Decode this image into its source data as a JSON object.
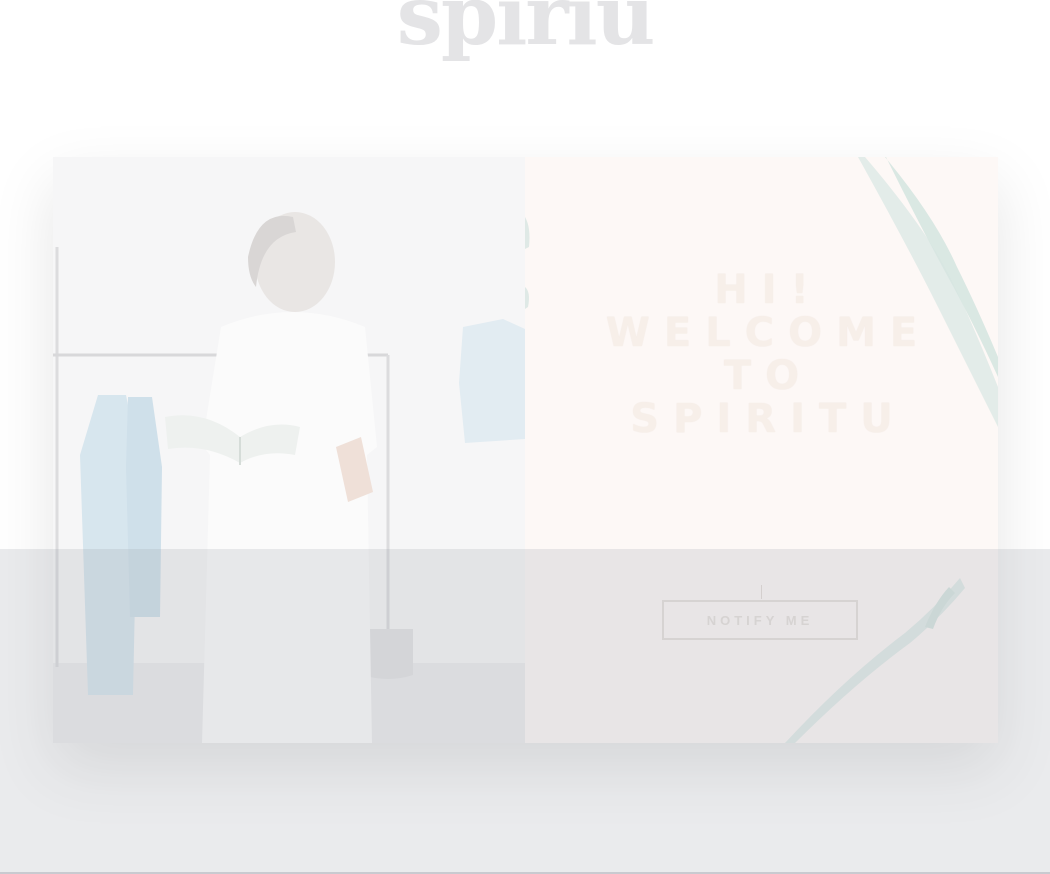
{
  "brand": {
    "logo_text": "spiriu"
  },
  "hero": {
    "headline_lines": [
      "HI!",
      "WELCOME",
      "TO",
      "SPIRITU"
    ],
    "subtext": "",
    "notify_label": "NOTIFY ME"
  },
  "colors": {
    "promo_background": "#fdf8f6",
    "brush_stroke": "#9fc3bd",
    "overlay": "#a0a2af"
  },
  "icons": [
    "brush-stroke-decoration"
  ]
}
